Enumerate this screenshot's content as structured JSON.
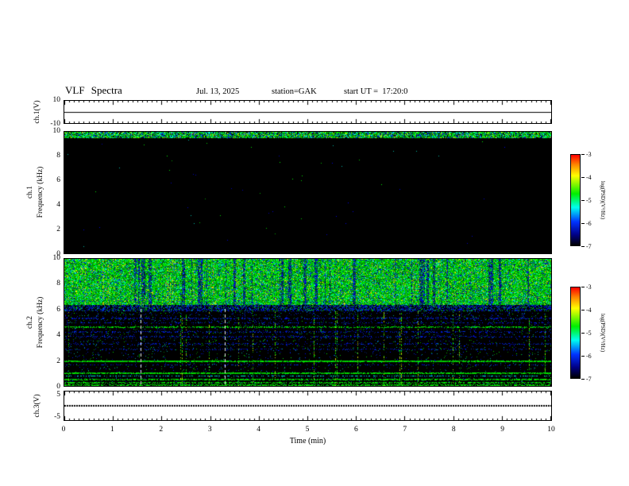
{
  "header": {
    "title": "VLF Spectra",
    "date": "Jul. 13, 2025",
    "station": "station=GAK",
    "start_ut": "start UT =  17:20:0"
  },
  "xaxis": {
    "label": "Time (min)",
    "min": 0,
    "max": 10,
    "ticks": [
      "0",
      "1",
      "2",
      "3",
      "4",
      "5",
      "6",
      "7",
      "8",
      "9",
      "10"
    ]
  },
  "colorbar": {
    "label": "log(PSD)(V²/Hz)",
    "ticks": [
      "-3",
      "-4",
      "-5",
      "-6",
      "-7"
    ],
    "value_range": [
      -7,
      -3
    ],
    "gradient": [
      {
        "color": "#ff0000",
        "pos": 0
      },
      {
        "color": "#ff8800",
        "pos": 11
      },
      {
        "color": "#ffff00",
        "pos": 23
      },
      {
        "color": "#00ee00",
        "pos": 43
      },
      {
        "color": "#00ffee",
        "pos": 58
      },
      {
        "color": "#0033ff",
        "pos": 74
      },
      {
        "color": "#000088",
        "pos": 88
      },
      {
        "color": "#000000",
        "pos": 100
      }
    ]
  },
  "chart_data": [
    {
      "type": "line",
      "panel": "ch1-voltage",
      "ylabel": "ch.1(V)",
      "ylim": [
        -10,
        10
      ],
      "yticks": [
        "10",
        "-10"
      ],
      "trace_value": 0,
      "trace_style": "solid"
    },
    {
      "type": "heatmap",
      "panel": "ch1-spectrogram",
      "ylabel_line1": "ch.1",
      "ylabel_line2": "Frequency (kHz)",
      "ylim": [
        0,
        10
      ],
      "yticks": [
        "10",
        "8",
        "6",
        "4",
        "2",
        "0"
      ],
      "background": "black",
      "bands": [
        {
          "f_min": 9.5,
          "f_max": 10,
          "style": "dense-green-teal-noise"
        }
      ],
      "speckle_probability": 0.0006,
      "seed": 1234567
    },
    {
      "type": "heatmap",
      "panel": "ch2-spectrogram",
      "ylabel_line1": "ch.2",
      "ylabel_line2": "Frequency (kHz)",
      "ylim": [
        0,
        10
      ],
      "yticks": [
        "10",
        "8",
        "6",
        "4",
        "2",
        "0"
      ],
      "background": "black",
      "bands": [
        {
          "f_min": 6.4,
          "f_max": 10,
          "style": "dense-green-noise-with-dark-blue-vertical-streaks"
        },
        {
          "f_min": 5.9,
          "f_max": 6.4,
          "style": "dark-blue-transition-band"
        },
        {
          "f_min": 0,
          "f_max": 5.9,
          "style": "sparse-blue-speckle-on-black"
        }
      ],
      "spectral_lines": [
        {
          "f": 5.35,
          "width": 0.05,
          "density": 0.3,
          "color": "blue"
        },
        {
          "f": 5.0,
          "width": 0.05,
          "density": 0.3,
          "color": "blue"
        },
        {
          "f": 4.65,
          "width": 0.06,
          "density": 0.55,
          "color": "green"
        },
        {
          "f": 4.3,
          "width": 0.05,
          "density": 0.3,
          "color": "blue"
        },
        {
          "f": 3.9,
          "width": 0.05,
          "density": 0.28,
          "color": "blue"
        },
        {
          "f": 3.35,
          "width": 0.05,
          "density": 0.22,
          "color": "blue"
        },
        {
          "f": 2.9,
          "width": 0.05,
          "density": 0.2,
          "color": "blue"
        },
        {
          "f": 1.95,
          "width": 0.07,
          "density": 0.92,
          "color": "green"
        },
        {
          "f": 1.7,
          "width": 0.05,
          "density": 0.3,
          "color": "blue"
        },
        {
          "f": 1.05,
          "width": 0.06,
          "density": 0.85,
          "color": "green"
        },
        {
          "f": 0.8,
          "width": 0.05,
          "density": 0.4,
          "color": "cyan"
        },
        {
          "f": 0.55,
          "width": 0.05,
          "density": 0.7,
          "color": "green"
        },
        {
          "f": 0.3,
          "width": 0.05,
          "density": 0.6,
          "color": "green"
        },
        {
          "f": 0.1,
          "width": 0.06,
          "density": 0.7,
          "color": "green"
        }
      ],
      "dropout_columns_min": [
        1.57,
        3.3
      ],
      "seed": 9876543
    },
    {
      "type": "line",
      "panel": "ch3-voltage",
      "ylabel": "ch.3(V)",
      "ylim": [
        -5,
        5
      ],
      "yticks": [
        "5",
        "-5"
      ],
      "trace_value": 0,
      "trace_style": "dotted-thick"
    }
  ]
}
